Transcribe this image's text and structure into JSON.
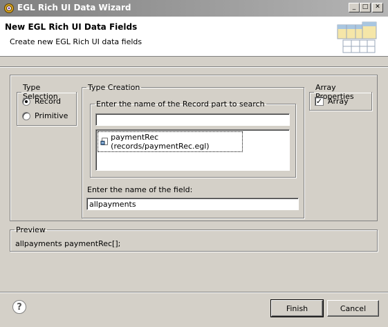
{
  "window": {
    "title": "EGL Rich UI Data Wizard",
    "min_icon": "_",
    "max_icon": "□",
    "close_icon": "✕"
  },
  "header": {
    "title": "New EGL Rich UI Data Fields",
    "description": "Create new EGL Rich UI data fields"
  },
  "type_selection": {
    "legend": "Type Selection",
    "options": [
      {
        "label": "Record",
        "selected": true
      },
      {
        "label": "Primitive",
        "selected": false
      }
    ]
  },
  "type_creation": {
    "legend": "Type Creation",
    "search_group": {
      "legend": "Enter the name of the Record part to search",
      "search_value": "",
      "results": [
        {
          "label": "paymentRec (records/paymentRec.egl)"
        }
      ]
    },
    "field_label": "Enter the name of the field:",
    "field_value": "allpayments"
  },
  "array_properties": {
    "legend": "Array Properties",
    "array_label": "Array",
    "array_checked": true,
    "check_mark": "✓"
  },
  "preview": {
    "legend": "Preview",
    "text": "allpayments paymentRec[];"
  },
  "buttons": {
    "help": "?",
    "finish": "Finish",
    "cancel": "Cancel"
  }
}
